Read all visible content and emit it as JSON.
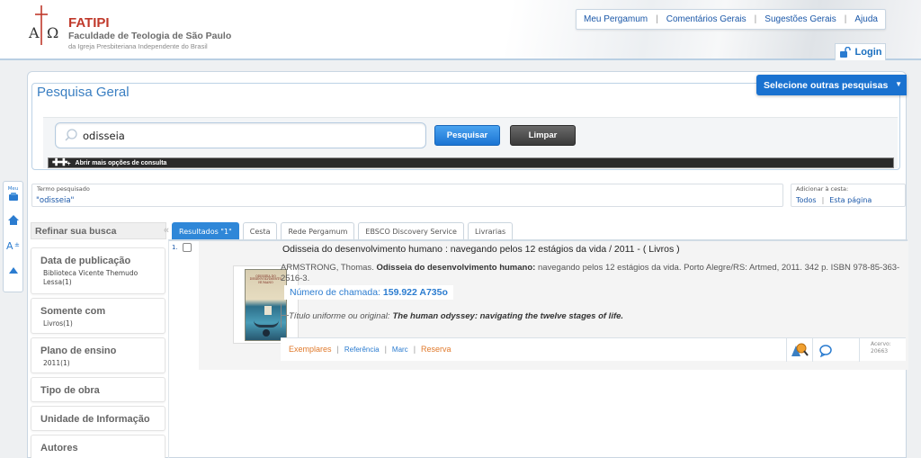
{
  "header": {
    "brand_name": "FATIPI",
    "brand_subtitle": "Faculdade de Teologia de São Paulo",
    "brand_tagline": "da Igreja Presbiteriana Independente do Brasil",
    "nav": [
      "Meu Pergamum",
      "Comentários Gerais",
      "Sugestões Gerais",
      "Ajuda"
    ],
    "login_label": "Login"
  },
  "toolbar": {
    "items": [
      "meu-pergamum-icon",
      "home-icon",
      "font-size-icon",
      "scroll-up-icon"
    ],
    "meu_label": "Meu"
  },
  "search": {
    "legend": "Pesquisa Geral",
    "select_other_label": "Selecione outras pesquisas",
    "query": "odisseia",
    "search_button": "Pesquisar",
    "clear_button": "Limpar",
    "more_options": "Abrir mais opções de consulta"
  },
  "term": {
    "label": "Termo pesquisado",
    "value": "\"odisseia\""
  },
  "cesta": {
    "label": "Adicionar à cesta:",
    "all": "Todos",
    "this_page": "Esta página"
  },
  "refine": {
    "title": "Refinar sua busca",
    "facets": [
      {
        "title": "Data de publicação",
        "values": [
          "Biblioteca Vicente Themudo Lessa(1)"
        ]
      },
      {
        "title": "Somente com",
        "values": [
          "Livros(1)"
        ]
      },
      {
        "title": "Plano de ensino",
        "values": [
          "2011(1)"
        ]
      },
      {
        "title": "Tipo de obra",
        "values": []
      },
      {
        "title": "Unidade de Informação",
        "values": []
      },
      {
        "title": "Autores",
        "values": []
      }
    ]
  },
  "tabs": [
    "Resultados \"1\"",
    "Cesta",
    "Rede Pergamum",
    "EBSCO Discovery Service",
    "Livrarias"
  ],
  "result": {
    "number": "1.",
    "title": "Odisseia do desenvolvimento humano : navegando pelos 12 estágios da vida / 2011 -  ( Livros )",
    "author": "ARMSTRONG, Thomas.",
    "title_bold": "Odisseia do desenvolvimento humano:",
    "description_rest": " navegando pelos 12 estágios da vida. Porto Alegre/RS: Artmed, 2011. 342 p. ISBN 978-85-363-2516-3.",
    "callno_label": "Número de chamada:",
    "callno_value": "159.922 A735o",
    "uniform_label": "Título uniforme ou original:",
    "uniform_value": "The human odyssey: navigating the twelve stages of life.",
    "cover_text": "ODISSEIA DO DESENVOLVIMENTO HUMANO",
    "actions": [
      "Exemplares",
      "Referência",
      "Marc",
      "Reserva"
    ],
    "acervo_label": "Acervo:",
    "acervo_value": "20663"
  },
  "colors": {
    "brand_red": "#c0392b",
    "link_blue": "#1a57a8",
    "accent_blue": "#1a72d0",
    "action_orange": "#e07a2c"
  }
}
